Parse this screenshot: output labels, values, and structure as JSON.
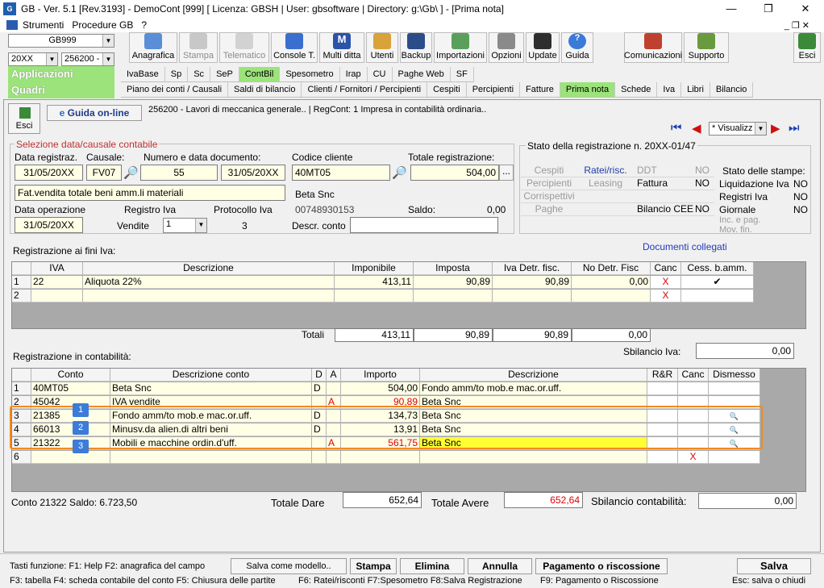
{
  "window": {
    "title": "GB - Ver. 5.1 [Rev.3193] -  DemoCont [999]      [ Licenza: GBSH | User: gbsoftware | Directory: g:\\Gb\\ ] - [Prima nota]"
  },
  "menu": {
    "items": [
      "Strumenti",
      "Procedure GB",
      "?"
    ]
  },
  "left_selectors": {
    "company": "GB999",
    "year": "20XX",
    "code": "256200 -",
    "applicazioni": "Applicazioni",
    "quadri": "Quadri"
  },
  "toolbar": {
    "buttons": [
      "Anagrafica",
      "Stampa",
      "Telematico",
      "Console T.",
      "Multi ditta",
      "Utenti",
      "Backup",
      "Importazioni",
      "Opzioni",
      "Update",
      "Guida",
      "Comunicazioni",
      "Supporto",
      "Esci"
    ]
  },
  "tabs_row1": [
    "IvaBase",
    "Sp",
    "Sc",
    "SeP",
    "ContBil",
    "Spesometro",
    "Irap",
    "CU",
    "Paghe Web",
    "SF"
  ],
  "tabs_row2": [
    "Piano dei conti / Causali",
    "Saldi di bilancio",
    "Clienti / Fornitori / Percipienti",
    "Cespiti",
    "Percipienti",
    "Fatture",
    "Prima nota",
    "Schede",
    "Iva",
    "Libri",
    "Bilancio"
  ],
  "header": {
    "esci": "Esci",
    "guida": "Guida on-line",
    "info": "256200 - Lavori di meccanica generale.. | RegCont: 1 Impresa  in contabilità ordinaria..",
    "view_select": "* Visualizz"
  },
  "selezione": {
    "title": "Selezione data/causale contabile",
    "data_reg_label": "Data registraz.",
    "data_reg": "31/05/20XX",
    "causale_label": "Causale:",
    "causale": "FV07",
    "numero_label": "Numero e data documento:",
    "numero": "55",
    "data_doc": "31/05/20XX",
    "desc_causale": "Fat.vendita totale beni amm.li materiali",
    "data_op_label": "Data operazione",
    "data_op": "31/05/20XX",
    "registro_label": "Registro Iva",
    "registro_name": "Vendite",
    "registro": "1",
    "protocollo_label": "Protocollo Iva",
    "protocollo": "3",
    "codice_label": "Codice cliente",
    "codice": "40MT05",
    "totale_label": "Totale registrazione:",
    "totale": "504,00",
    "cliente_nome": "Beta Snc",
    "cliente_piva": "00748930153",
    "saldo_label": "Saldo:",
    "saldo": "0,00",
    "descr_conto_label": "Descr. conto",
    "descr_conto": ""
  },
  "stato": {
    "title": "Stato della registrazione n. 20XX-01/47",
    "left": [
      [
        "Cespiti",
        "Ratei/risc.",
        "DDT",
        "NO"
      ],
      [
        "Percipienti",
        "Leasing",
        "Fattura",
        "NO"
      ],
      [
        "Corrispettivi",
        "",
        "",
        ""
      ],
      [
        "Paghe",
        "",
        "Bilancio CEE",
        "NO"
      ]
    ],
    "stampe_title": "Stato delle stampe:",
    "stampe": [
      [
        "Liquidazione Iva",
        "NO"
      ],
      [
        "Registri Iva",
        "NO"
      ],
      [
        "Giornale",
        "NO"
      ],
      [
        "Inc. e pag. Mov. fin.",
        ""
      ]
    ]
  },
  "iva": {
    "title": "Registrazione ai fini Iva:",
    "documenti": "Documenti collegati",
    "headers": [
      "IVA",
      "Descrizione",
      "Imponibile",
      "Imposta",
      "Iva Detr. fisc.",
      "No Detr. Fisc",
      "Canc",
      "Cess. b.amm."
    ],
    "rows": [
      {
        "n": "1",
        "iva": "22",
        "desc": "Aliquota 22%",
        "imponibile": "413,11",
        "imposta": "90,89",
        "detr": "90,89",
        "nodetr": "0,00",
        "canc": "X",
        "cess": "✔"
      },
      {
        "n": "2",
        "iva": "",
        "desc": "",
        "imponibile": "",
        "imposta": "",
        "detr": "",
        "nodetr": "",
        "canc": "X",
        "cess": ""
      }
    ],
    "totali_label": "Totali",
    "totali": [
      "413,11",
      "90,89",
      "90,89",
      "0,00"
    ],
    "sbilancio_label": "Sbilancio Iva:",
    "sbilancio": "0,00"
  },
  "contabilita": {
    "title": "Registrazione in contabilità:",
    "headers": [
      "Conto",
      "Descrizione conto",
      "D",
      "A",
      "Importo",
      "Descrizione",
      "R&R",
      "Canc",
      "Dismesso"
    ],
    "rows": [
      {
        "n": "1",
        "conto": "40MT05",
        "desc": "Beta Snc",
        "d": "D",
        "a": "",
        "importo": "504,00",
        "descr": "Fondo amm/to mob.e mac.or.uff.",
        "red": false
      },
      {
        "n": "2",
        "conto": "45042",
        "desc": "IVA vendite",
        "d": "",
        "a": "A",
        "importo": "90,89",
        "descr": "Beta Snc",
        "red": true
      },
      {
        "n": "3",
        "conto": "21385",
        "desc": "Fondo amm/to mob.e mac.or.uff.",
        "d": "D",
        "a": "",
        "importo": "134,73",
        "descr": "Beta Snc",
        "red": false
      },
      {
        "n": "4",
        "conto": "66013",
        "desc": "Minusv.da alien.di altri beni",
        "d": "D",
        "a": "",
        "importo": "13,91",
        "descr": "Beta Snc",
        "red": false
      },
      {
        "n": "5",
        "conto": "21322",
        "desc": "Mobili e macchine ordin.d'uff.",
        "d": "",
        "a": "A",
        "importo": "561,75",
        "descr": "Beta Snc",
        "red": true
      },
      {
        "n": "6",
        "conto": "",
        "desc": "",
        "d": "",
        "a": "",
        "importo": "",
        "descr": "",
        "red": false
      }
    ],
    "badges": [
      "1",
      "2",
      "3"
    ],
    "conto_saldo": "Conto 21322 Saldo: 6.723,50",
    "totale_dare_label": "Totale Dare",
    "totale_dare": "652,64",
    "totale_avere_label": "Totale Avere",
    "totale_avere": "652,64",
    "sbilancio_label": "Sbilancio contabilità:",
    "sbilancio": "0,00"
  },
  "footer": {
    "help1": "Tasti funzione: F1: Help  F2: anagrafica del campo",
    "salva_modello": "Salva come modello..",
    "stampa": "Stampa",
    "elimina": "Elimina",
    "annulla": "Annulla",
    "pagamento": "Pagamento o riscossione",
    "salva": "Salva",
    "help2": "F3: tabella    F4: scheda contabile del conto   F5: Chiusura delle partite",
    "help3": "F6: Ratei/risconti   F7:Spesometro   F8:Salva Registrazione",
    "help4": "F9: Pagamento o Riscossione",
    "help5": "Esc: salva o chiudi"
  }
}
